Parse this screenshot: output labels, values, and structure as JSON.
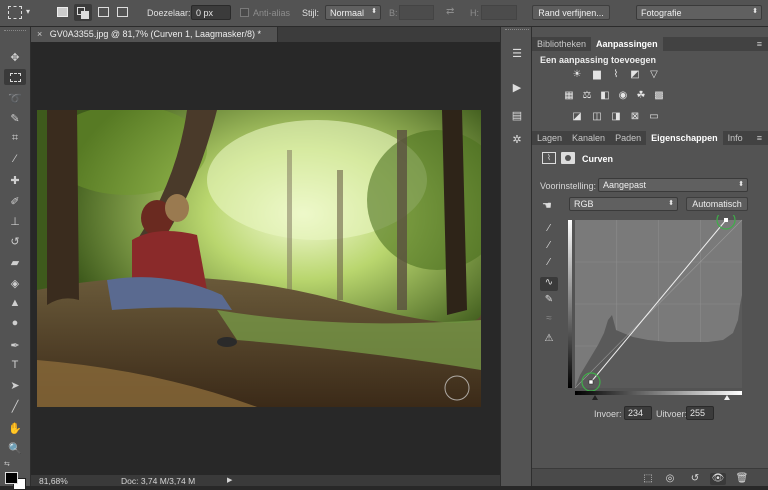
{
  "options_bar": {
    "feather_label": "Doezelaar:",
    "feather_value": "0 px",
    "antialias_label": "Anti-alias",
    "style_label": "Stijl:",
    "style_value": "Normaal",
    "width_label": "B:",
    "height_label": "H:",
    "refine_button": "Rand verfijnen...",
    "workspace_value": "Fotografie"
  },
  "document": {
    "tab_title": "GV0A3355.jpg @ 81,7% (Curven 1, Laagmasker/8) *",
    "close_glyph": "×"
  },
  "status_bar": {
    "zoom": "81,68%",
    "doc_size": "Doc: 3,74 M/3,74 M",
    "arrow": "▶"
  },
  "top_panel": {
    "tabs": [
      "Bibliotheken",
      "Aanpassingen"
    ],
    "active_tab": "Aanpassingen",
    "heading": "Een aanpassing toevoegen"
  },
  "lower_panel": {
    "tabs": [
      "Lagen",
      "Kanalen",
      "Paden",
      "Eigenschappen",
      "Info"
    ],
    "active_tab": "Eigenschappen",
    "title": "Curven",
    "preset_label": "Voorinstelling:",
    "preset_value": "Aangepast",
    "channel_value": "RGB",
    "auto_button": "Automatisch",
    "input_label": "Invoer:",
    "input_value": "234",
    "output_label": "Uitvoer:",
    "output_value": "255"
  },
  "colors": {
    "panel_bg": "#535353",
    "canvas_bg": "#282828",
    "curve_point_ring": "#3fae49"
  }
}
